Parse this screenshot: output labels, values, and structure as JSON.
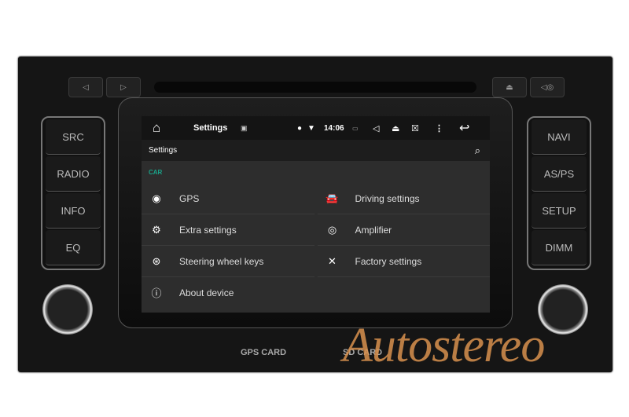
{
  "device": {
    "top_buttons": {
      "prev": "◁",
      "next": "▷",
      "eject": "⏏",
      "mute": "◁◎"
    },
    "left_buttons": [
      "SRC",
      "RADIO",
      "INFO",
      "EQ"
    ],
    "right_buttons": [
      "NAVI",
      "AS/PS",
      "SETUP",
      "DIMM"
    ],
    "card_slots": [
      "GPS CARD",
      "SD CARD"
    ],
    "watermark": "Autostereo"
  },
  "statusbar": {
    "title": "Settings",
    "time": "14:06"
  },
  "appbar": {
    "title": "Settings"
  },
  "section": {
    "label": "CAR"
  },
  "accent": "#1aa389",
  "items": [
    {
      "label": "GPS",
      "icon": "gps-icon"
    },
    {
      "label": "Driving settings",
      "icon": "car-icon"
    },
    {
      "label": "Extra settings",
      "icon": "gears-icon"
    },
    {
      "label": "Amplifier",
      "icon": "speaker-icon"
    },
    {
      "label": "Steering wheel keys",
      "icon": "steering-wheel-icon"
    },
    {
      "label": "Factory settings",
      "icon": "tools-icon"
    },
    {
      "label": "About device",
      "icon": "info-icon"
    }
  ]
}
